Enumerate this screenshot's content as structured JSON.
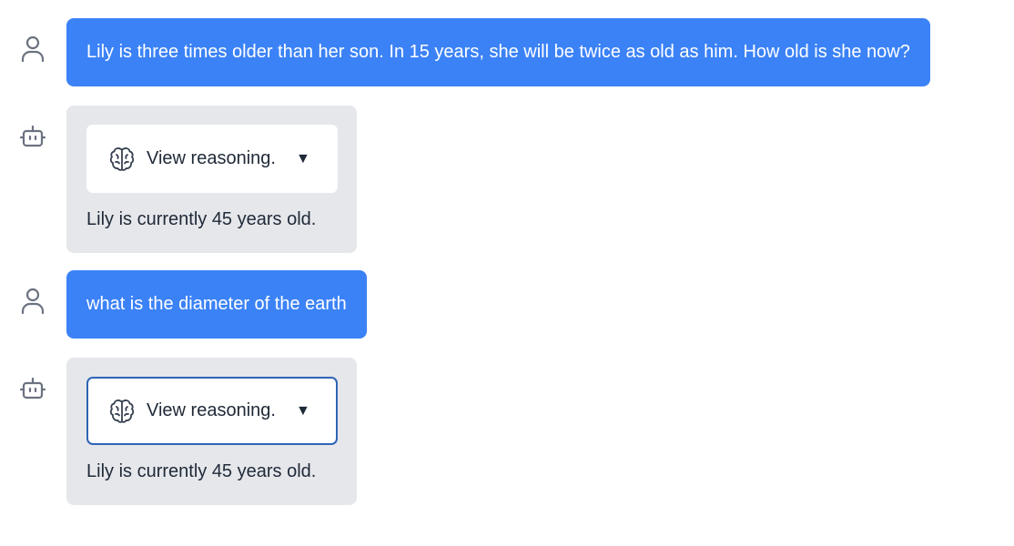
{
  "messages": [
    {
      "role": "user",
      "avatar_icon": "user-icon",
      "text": "Lily is three times older than her son. In 15 years, she will be twice as old as him. How old is she now?"
    },
    {
      "role": "assistant",
      "avatar_icon": "robot-icon",
      "reasoning_label": "View reasoning.",
      "reasoning_icon": "brain-icon",
      "caret": "▼",
      "text": "Lily is currently 45 years old."
    },
    {
      "role": "user",
      "avatar_icon": "user-icon",
      "text": "what is the diameter of the earth"
    },
    {
      "role": "assistant",
      "avatar_icon": "robot-icon",
      "reasoning_label": "View reasoning.",
      "reasoning_icon": "brain-icon",
      "caret": "▼",
      "text": "Lily is currently 45 years old."
    }
  ],
  "colors": {
    "user_bubble": "#3b82f6",
    "assistant_bubble": "#e5e7eb",
    "focus_ring": "#2f64b5",
    "icon": "#6b7280"
  }
}
